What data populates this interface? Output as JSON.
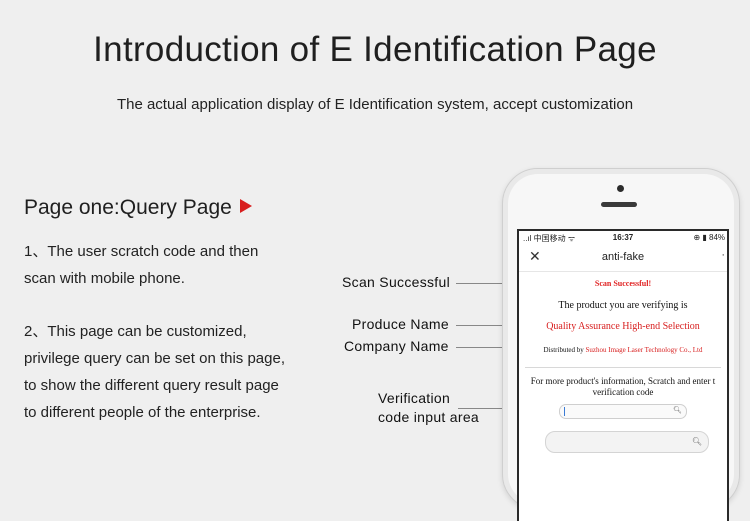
{
  "header": {
    "title": "Introduction of E Identification Page",
    "subtitle": "The actual application display of E Identification system, accept customization"
  },
  "section": {
    "title": "Page one:Query Page",
    "para1": [
      "1、The user scratch code and then",
      "scan with mobile phone."
    ],
    "para2": [
      "2、This page can be customized,",
      "privilege query can be set on this page,",
      "to show the different query result page",
      "to different people of the enterprise."
    ]
  },
  "annotations": {
    "scan_successful": "Scan Successful",
    "produce_name": "Produce Name",
    "company_name": "Company Name",
    "verification_1": "Verification",
    "verification_2": "code input area"
  },
  "phone": {
    "status": {
      "carrier": "..ıl 中国移动 ᯤ",
      "time": "16:37",
      "battery": "⊕ ▮ 84%"
    },
    "nav": {
      "close": "✕",
      "title": "anti-fake",
      "more": "·"
    },
    "screen": {
      "success": "Scan Successful!",
      "verifying": "The product you are verifying is",
      "product": "Quality Assurance High-end Selection",
      "distributed_by": "Distributed by",
      "company": "Suzhou Image Laser Technology Co., Ltd",
      "info_1": "For more product's information, Scratch and enter t",
      "info_2": "verification code"
    }
  },
  "colors": {
    "accent": "#d81e1e",
    "background": "#efefef"
  }
}
